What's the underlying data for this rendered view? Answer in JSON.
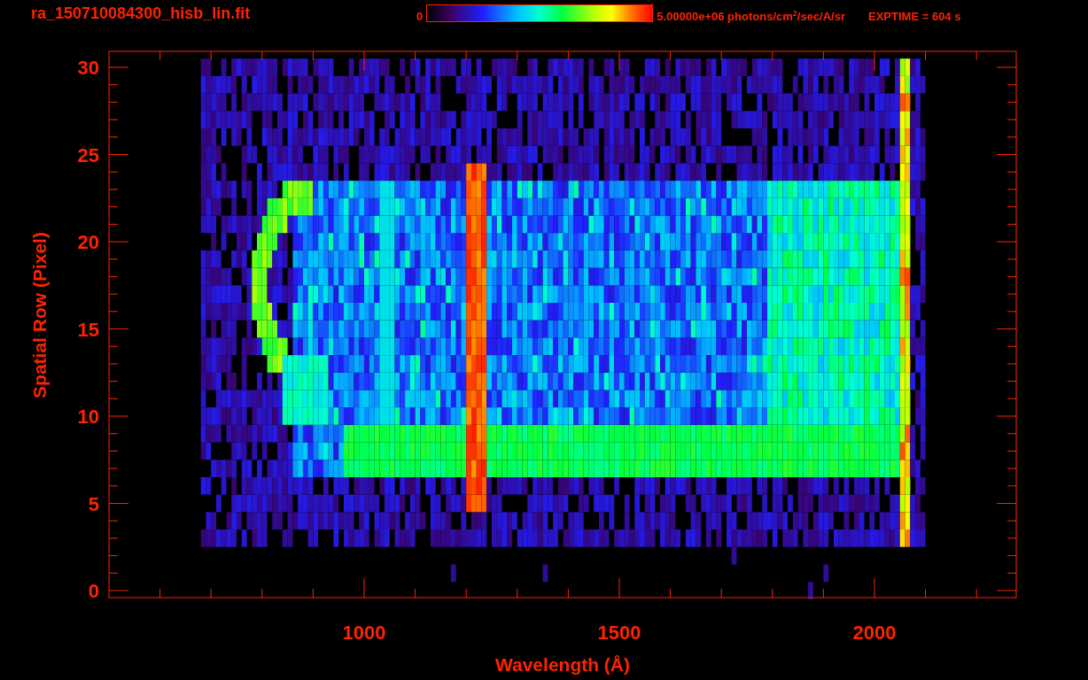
{
  "title": "ra_150710084300_hisb_lin.fit",
  "colorbar": {
    "min_label": "0",
    "max_label": "5.00000e+06 photons/cm$^{2}$/sec/A/sr"
  },
  "exposure": "EXPTIME = 604 s",
  "plot": {
    "ylabel": "Spatial Row (Pixel)",
    "xlabel": "Wavelength (Å)",
    "yticks": [
      "30",
      "25",
      "20",
      "15",
      "10",
      "5",
      "0"
    ],
    "xticks": [
      "1000",
      "1500",
      "2000"
    ]
  }
}
